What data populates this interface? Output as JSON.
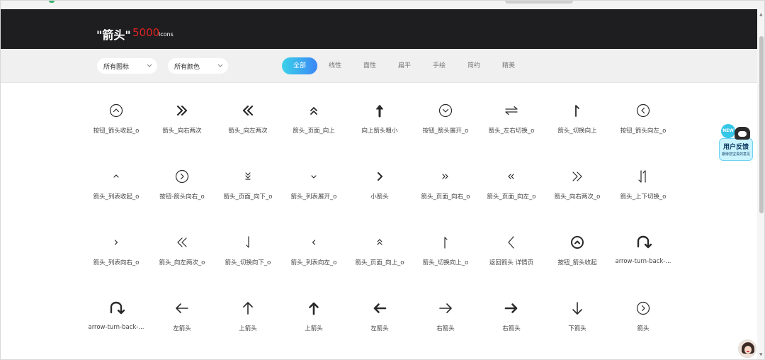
{
  "header": {
    "keyword": "\"箭头\"",
    "count": "5000",
    "unit": "icons"
  },
  "filters": {
    "icon_select": "所有图标",
    "color_select": "所有颜色",
    "tabs": [
      "全部",
      "线性",
      "面性",
      "扁平",
      "手绘",
      "简约",
      "精美"
    ],
    "active_tab": "全部"
  },
  "icons": [
    {
      "label": "按钮_箭头收起_o",
      "icon": "circle-chevron-up-icon"
    },
    {
      "label": "箭头_向右两次",
      "icon": "double-chevron-right-icon"
    },
    {
      "label": "箭头_向左两次",
      "icon": "double-chevron-left-icon"
    },
    {
      "label": "箭头_页面_向上",
      "icon": "double-chevron-up-icon"
    },
    {
      "label": "向上箭头粗小",
      "icon": "thick-arrow-up-icon"
    },
    {
      "label": "按钮_箭头展开_o",
      "icon": "circle-chevron-down-icon"
    },
    {
      "label": "箭头_左右切换_o",
      "icon": "swap-left-right-icon"
    },
    {
      "label": "箭头_切换向上",
      "icon": "hook-arrow-up-icon"
    },
    {
      "label": "按钮_箭头向左_o",
      "icon": "circle-chevron-left-icon"
    },
    {
      "label": "箭头_列表收起_o",
      "icon": "chevron-up-icon"
    },
    {
      "label": "按钮-箭头向右_o",
      "icon": "circle-chevron-right-icon"
    },
    {
      "label": "箭头_页面_向下_o",
      "icon": "double-chevron-down-icon"
    },
    {
      "label": "箭头_列表展开_o",
      "icon": "chevron-down-icon"
    },
    {
      "label": "小箭头",
      "icon": "bold-chevron-right-icon"
    },
    {
      "label": "箭头_页面_向右_o",
      "icon": "small-double-chevron-right-icon"
    },
    {
      "label": "箭头_页面_向左_o",
      "icon": "small-double-chevron-left-icon"
    },
    {
      "label": "箭头_向右两次_o",
      "icon": "thin-double-chevron-right-icon"
    },
    {
      "label": "箭头_上下切换_o",
      "icon": "swap-up-down-icon"
    },
    {
      "label": "箭头_列表向右_o",
      "icon": "small-chevron-right-icon"
    },
    {
      "label": "箭头_向左两次_o",
      "icon": "thin-double-chevron-left-icon"
    },
    {
      "label": "箭头_切换向下_o",
      "icon": "hook-arrow-down-icon"
    },
    {
      "label": "箭头_列表向左_o",
      "icon": "small-chevron-left-icon"
    },
    {
      "label": "箭头_页面_向上_o",
      "icon": "thin-double-chevron-up-icon"
    },
    {
      "label": "箭头_切换向上_o",
      "icon": "thin-hook-arrow-up-icon"
    },
    {
      "label": "返回箭头 详情页",
      "icon": "large-chevron-left-icon"
    },
    {
      "label": "按钮_箭头收起",
      "icon": "filled-circle-chevron-up-icon"
    },
    {
      "label": "arrow-turn-back-...",
      "icon": "arrow-turn-back-down-right-icon"
    },
    {
      "label": "arrow-turn-back-...",
      "icon": "arrow-turn-back-down-right-icon"
    },
    {
      "label": "左箭头",
      "icon": "arrow-left-icon"
    },
    {
      "label": "上箭头",
      "icon": "arrow-up-icon"
    },
    {
      "label": "上箭头",
      "icon": "bold-arrow-up-icon"
    },
    {
      "label": "左箭头",
      "icon": "bold-arrow-left-icon"
    },
    {
      "label": "右箭头",
      "icon": "arrow-right-icon"
    },
    {
      "label": "右箭头",
      "icon": "bold-arrow-right-icon"
    },
    {
      "label": "下箭头",
      "icon": "arrow-down-icon"
    },
    {
      "label": "箭头",
      "icon": "circle-chevron-right-icon"
    }
  ],
  "feedback": {
    "badge": "NEW",
    "title": "用户反馈",
    "subtitle": "期待您宝贵的意见"
  },
  "colors": {
    "header_bg": "#1e1e21",
    "count_red": "#e32121",
    "accent_from": "#3bd2e9",
    "accent_to": "#3b86f5"
  }
}
